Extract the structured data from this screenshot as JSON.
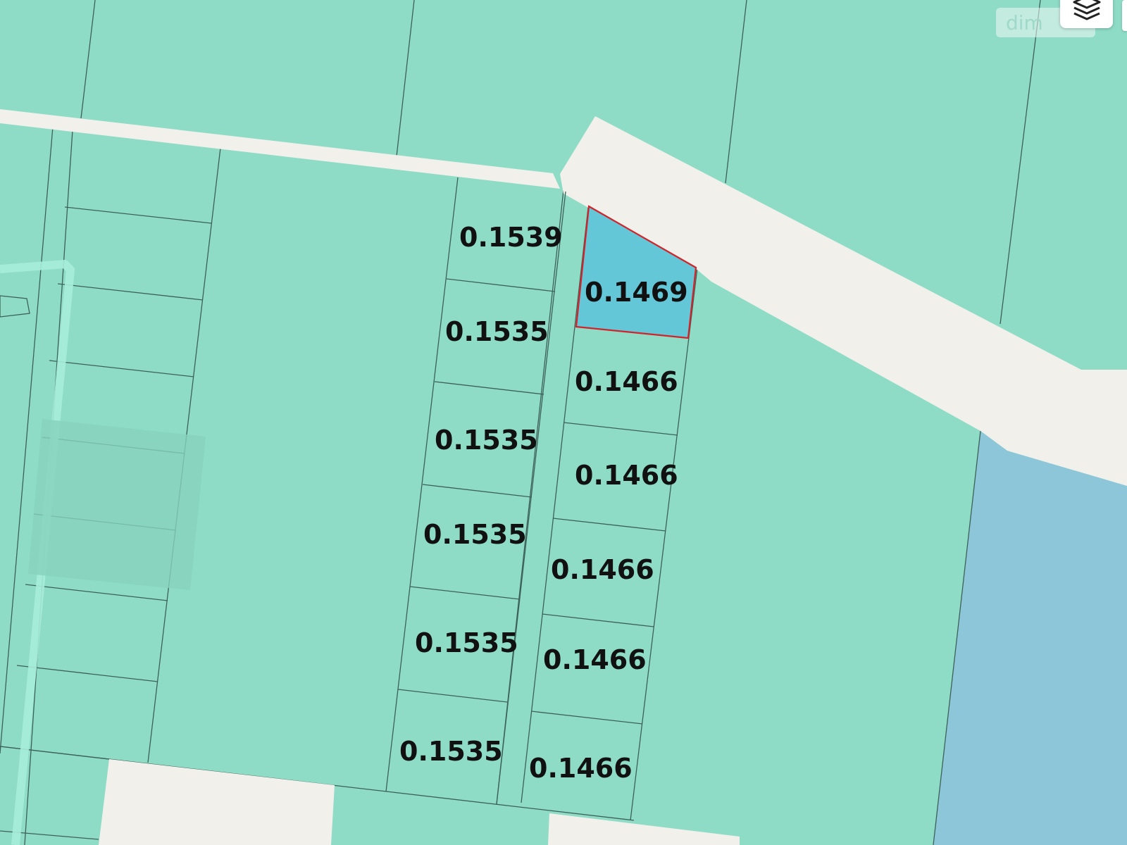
{
  "map": {
    "colors": {
      "parcel_fill": "#8fdcc6",
      "parcel_border": "#3d6158",
      "road": "#f1f0eb",
      "water": "#8cc6d8",
      "selected_fill": "#63c7d8",
      "selected_border": "#d2232a",
      "label_text": "#111111"
    },
    "selected_parcel": {
      "area": "0.1469"
    },
    "parcel_labels": [
      "0.1539",
      "0.1535",
      "0.1535",
      "0.1535",
      "0.1535",
      "0.1535",
      "0.1466",
      "0.1466",
      "0.1466",
      "0.1466",
      "0.1466"
    ]
  },
  "controls": {
    "attribution_badge": "dim",
    "layers_icon": "layers-icon"
  }
}
